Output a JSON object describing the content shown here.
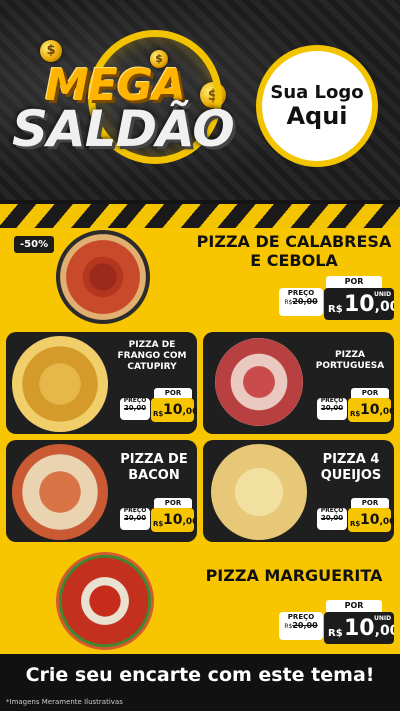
{
  "header": {
    "title_line1": "MEGA",
    "title_line2": "SALDÃO",
    "logo_line1": "Sua Logo",
    "logo_line2": "Aqui",
    "coin_symbol": "$"
  },
  "products": [
    {
      "name_line1": "PIZZA DE CALABRESA",
      "name_line2": "E CEBOLA",
      "badge": "-50%",
      "por_label": "POR",
      "preco_label": "PREÇO",
      "old_prefix": "R$",
      "old_price": "20,00",
      "currency": "R$",
      "price_int": "10",
      "price_dec": ",00",
      "unit": "UNID"
    },
    {
      "name_line1": "PIZZA DE",
      "name_line2": "FRANGO COM",
      "name_line3": "CATUPIRY",
      "por_label": "POR",
      "preco_label": "PREÇO",
      "old_prefix": "R$",
      "old_price": "20,00",
      "currency": "R$",
      "price_int": "10",
      "price_dec": ",00",
      "unit": "UNID"
    },
    {
      "name_line1": "PIZZA",
      "name_line2": "PORTUGUESA",
      "por_label": "POR",
      "preco_label": "PREÇO",
      "old_prefix": "R$",
      "old_price": "20,00",
      "currency": "R$",
      "price_int": "10",
      "price_dec": ",00",
      "unit": "UNID"
    },
    {
      "name_line1": "PIZZA DE",
      "name_line2": "BACON",
      "por_label": "POR",
      "preco_label": "PREÇO",
      "old_prefix": "R$",
      "old_price": "20,00",
      "currency": "R$",
      "price_int": "10",
      "price_dec": ",00",
      "unit": "UNID"
    },
    {
      "name_line1": "PIZZA 4",
      "name_line2": "QUEIJOS",
      "por_label": "POR",
      "preco_label": "PREÇO",
      "old_prefix": "R$",
      "old_price": "20,00",
      "currency": "R$",
      "price_int": "10",
      "price_dec": ",00",
      "unit": "UNID"
    },
    {
      "name_line1": "PIZZA MARGUERITA",
      "por_label": "POR",
      "preco_label": "PREÇO",
      "old_prefix": "R$",
      "old_price": "20,00",
      "currency": "R$",
      "price_int": "10",
      "price_dec": ",00",
      "unit": "UNID"
    }
  ],
  "footer": {
    "cta": "Crie seu encarte com este tema!",
    "disclaimer": "*Imagens Meramente Ilustrativas"
  },
  "colors": {
    "accent": "#f7c600",
    "dark": "#1f1f1f"
  }
}
